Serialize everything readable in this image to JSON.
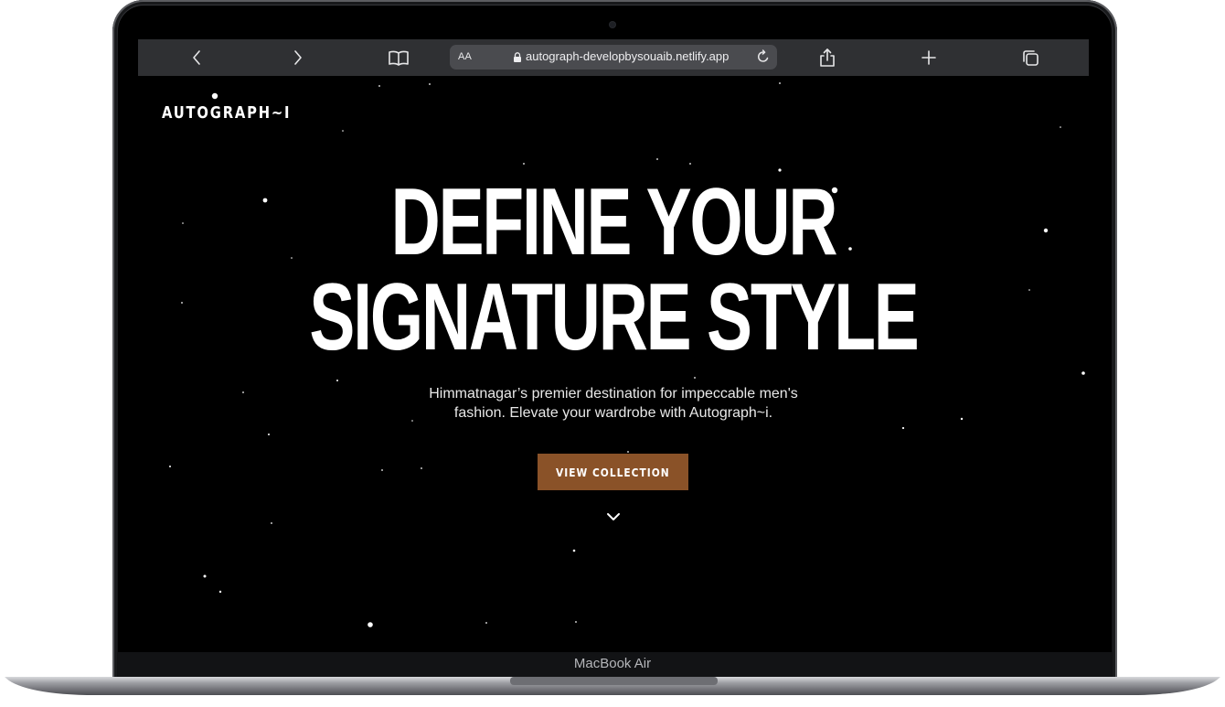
{
  "device": {
    "label": "MacBook Air"
  },
  "browser": {
    "back_icon": "chevron-left-icon",
    "forward_icon": "chevron-right-icon",
    "bookmarks_icon": "book-icon",
    "reader_label": "AA",
    "url": "autograph-developbysouaib.netlify.app",
    "reload_icon": "reload-icon",
    "share_icon": "share-icon",
    "new_tab_icon": "plus-icon",
    "tabs_icon": "tabs-icon"
  },
  "site": {
    "brand": "AUTOGRAPH~I",
    "hero": {
      "title_line1": "DEFINE YOUR",
      "title_line2": "SIGNATURE STYLE",
      "subtitle": "Himmatnagar’s premier destination for impeccable men's fashion. Elevate your wardrobe with Autograph~i.",
      "cta_label": "VIEW COLLECTION",
      "scroll_icon": "chevron-down-icon"
    }
  },
  "colors": {
    "page_background": "#000000",
    "accent": "#8a5228",
    "toolbar": "#2f3033",
    "text": "#ffffff"
  }
}
